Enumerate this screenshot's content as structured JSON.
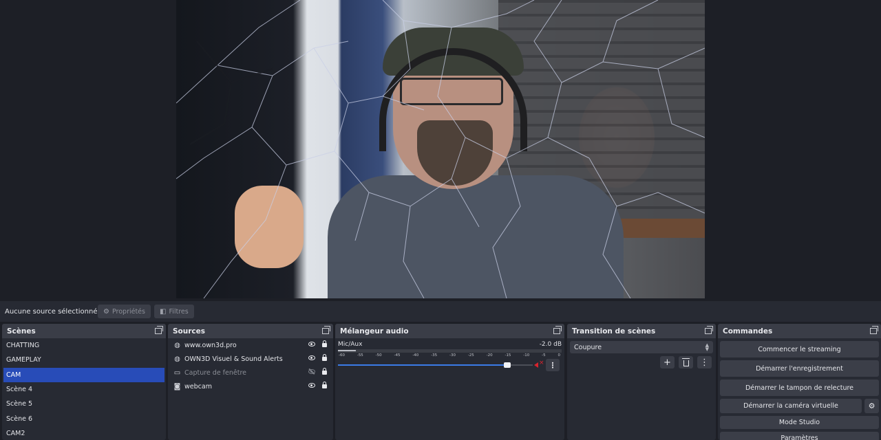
{
  "source_toolbar": {
    "status": "Aucune source sélectionné",
    "properties_label": "Propriétés",
    "filters_label": "Filtres"
  },
  "scenes": {
    "title": "Scènes",
    "items": [
      {
        "label": "CHATTING",
        "active": false
      },
      {
        "label": "GAMEPLAY",
        "active": false
      },
      {
        "label": "CAM",
        "active": true
      },
      {
        "label": "Scène 4",
        "active": false
      },
      {
        "label": "Scène 5",
        "active": false
      },
      {
        "label": "Scène 6",
        "active": false
      },
      {
        "label": "CAM2",
        "active": false
      }
    ]
  },
  "sources": {
    "title": "Sources",
    "items": [
      {
        "label": "www.own3d.pro",
        "icon": "globe-icon",
        "visible": true,
        "locked": true
      },
      {
        "label": "OWN3D Visuel & Sound Alerts",
        "icon": "globe-icon",
        "visible": true,
        "locked": true
      },
      {
        "label": "Capture de fenêtre",
        "icon": "window-icon",
        "visible": false,
        "locked": true
      },
      {
        "label": "webcam",
        "icon": "camera-icon",
        "visible": true,
        "locked": true
      }
    ]
  },
  "mixer": {
    "title": "Mélangeur audio",
    "channel": {
      "name": "Mic/Aux",
      "volume": "-2.0 dB",
      "volume_fraction": 0.87,
      "muted": true,
      "ticks": [
        "-60",
        "-55",
        "-50",
        "-45",
        "-40",
        "-35",
        "-30",
        "-25",
        "-20",
        "-15",
        "-10",
        "-5",
        "0"
      ]
    }
  },
  "transitions": {
    "title": "Transition de scènes",
    "selected": "Coupure"
  },
  "controls": {
    "title": "Commandes",
    "start_streaming": "Commencer le streaming",
    "start_recording": "Démarrer l'enregistrement",
    "start_replay": "Démarrer le tampon de relecture",
    "start_virtual_cam": "Démarrer la caméra virtuelle",
    "studio_mode": "Mode Studio",
    "settings": "Paramètres"
  },
  "colors": {
    "accent": "#284cb8",
    "fader": "#3b7be8",
    "mute": "#d9232d"
  }
}
